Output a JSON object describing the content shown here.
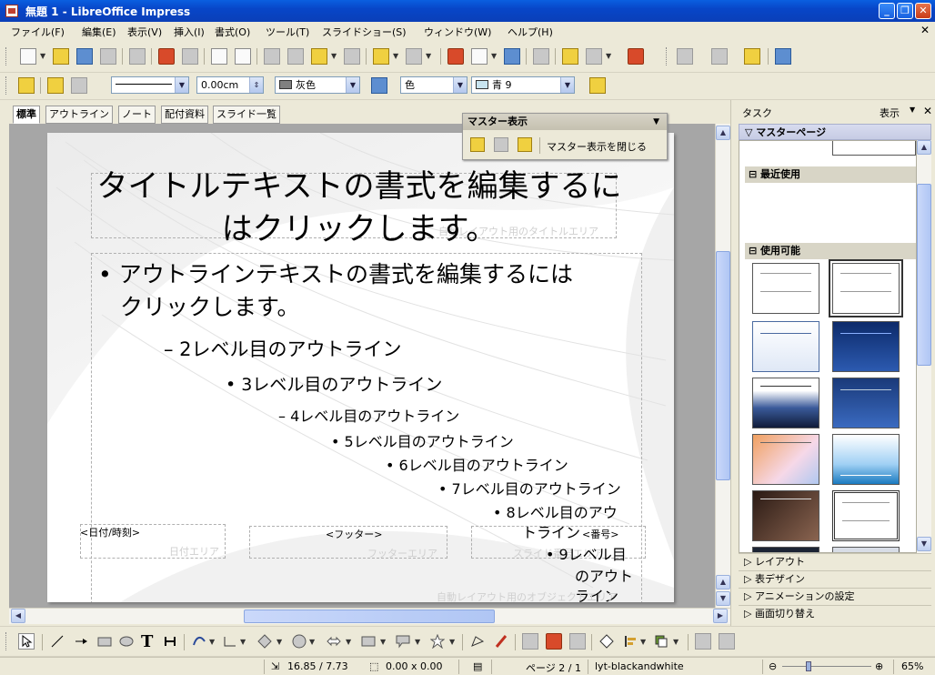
{
  "window": {
    "title": "無題 1 - LibreOffice Impress",
    "buttons": {
      "minimize": "_",
      "restore": "❐",
      "close": "✕"
    }
  },
  "menubar": {
    "items": [
      "ファイル(F)",
      "編集(E)",
      "表示(V)",
      "挿入(I)",
      "書式(O)",
      "ツール(T)",
      "スライドショー(S)",
      "ウィンドウ(W)",
      "ヘルプ(H)"
    ],
    "close_doc": "✕"
  },
  "line_toolbar": {
    "line_width": "0.00cm",
    "line_color": "灰色",
    "area_style": "色",
    "area_color": "青 9",
    "colors": {
      "line_color": "#808080",
      "area_color": "#c8e4f0"
    }
  },
  "view_tabs": [
    "標準",
    "アウトライン",
    "ノート",
    "配付資料",
    "スライド一覧"
  ],
  "master_toolbar": {
    "title": "マスター表示",
    "close_label": "マスター表示を閉じる"
  },
  "slide": {
    "title_text": "タイトルテキストの書式を編集するにはクリックします。",
    "title_area_caption": "自動レイアウト用のタイトルエリア",
    "outline": [
      "• アウトラインテキストの書式を編集するには",
      "クリックします。",
      "– 2レベル目のアウトライン",
      "• 3レベル目のアウトライン",
      "– 4レベル目のアウトライン",
      "• 5レベル目のアウトライン",
      "• 6レベル目のアウトライン",
      "• 7レベル目のアウトライン",
      "• 8レベル目のアウ",
      "トライン",
      "• 9レベル目",
      "のアウト",
      "ライン"
    ],
    "object_area_caption": "自動レイアウト用のオブジェクトエリア",
    "date_field": "<日付/時刻>",
    "date_area_caption": "日付エリア",
    "footer_field": "<フッター>",
    "footer_area_caption": "フッターエリア",
    "number_field": "<番号>",
    "slide_number_caption": "スライド番号エリア"
  },
  "taskpane": {
    "title": "タスク",
    "view_label": "表示",
    "close": "✕",
    "sections": {
      "master_pages": "マスターページ",
      "recently_used": "最近使用",
      "available": "使用可能",
      "layout": "レイアウト",
      "table_design": "表デザイン",
      "animation": "アニメーションの設定",
      "transition": "画面切り替え"
    },
    "thumbnails": [
      {
        "style": "white",
        "selected": false
      },
      {
        "style": "white",
        "selected": true
      },
      {
        "style": "blue-frame",
        "selected": false
      },
      {
        "style": "dark-blue",
        "selected": false
      },
      {
        "style": "blue-gradient",
        "selected": false
      },
      {
        "style": "navy",
        "selected": false
      },
      {
        "style": "orange",
        "selected": false
      },
      {
        "style": "sky",
        "selected": false
      },
      {
        "style": "brown",
        "selected": false
      },
      {
        "style": "frame",
        "selected": false
      }
    ]
  },
  "statusbar": {
    "position": "16.85 / 7.73",
    "size": "0.00 x 0.00",
    "page": "ページ 2 / 1",
    "master": "lyt-blackandwhite",
    "zoom": "65%"
  },
  "theme_colors": {
    "titlebar": "#0a4fd6",
    "chrome": "#ece9d8",
    "workspace": "#a6a6a6",
    "selection": "#316ac5"
  }
}
